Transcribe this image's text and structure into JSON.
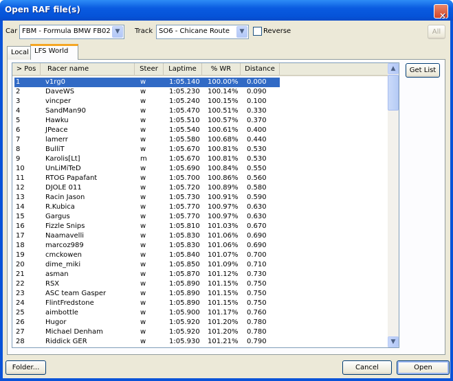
{
  "window": {
    "title": "Open RAF file(s)",
    "close_icon": "close-icon"
  },
  "toolbar": {
    "car_label": "Car",
    "car_value": "FBM - Formula BMW FB02",
    "track_label": "Track",
    "track_value": "SO6 - Chicane Route",
    "reverse_label": "Reverse",
    "reverse_checked": false,
    "all_label": "All"
  },
  "tabs": [
    {
      "label": "Local",
      "active": false
    },
    {
      "label": "LFS World",
      "active": true
    }
  ],
  "table": {
    "columns": [
      "> Pos",
      "Racer name",
      "Steer",
      "Laptime",
      "% WR",
      "Distance"
    ],
    "rows": [
      [
        "1",
        "v1rg0",
        "w",
        "1:05.140",
        "100.00%",
        "0.000"
      ],
      [
        "2",
        "DaveWS",
        "w",
        "1:05.230",
        "100.14%",
        "0.090"
      ],
      [
        "3",
        "vincper",
        "w",
        "1:05.240",
        "100.15%",
        "0.100"
      ],
      [
        "4",
        "SandMan90",
        "w",
        "1:05.470",
        "100.51%",
        "0.330"
      ],
      [
        "5",
        "Hawku",
        "w",
        "1:05.510",
        "100.57%",
        "0.370"
      ],
      [
        "6",
        "JPeace",
        "w",
        "1:05.540",
        "100.61%",
        "0.400"
      ],
      [
        "7",
        "lamerr",
        "w",
        "1:05.580",
        "100.68%",
        "0.440"
      ],
      [
        "8",
        "BulliT",
        "w",
        "1:05.670",
        "100.81%",
        "0.530"
      ],
      [
        "9",
        "Karolis[Lt]",
        "m",
        "1:05.670",
        "100.81%",
        "0.530"
      ],
      [
        "10",
        "UnLiMiTeD",
        "w",
        "1:05.690",
        "100.84%",
        "0.550"
      ],
      [
        "11",
        "RTOG Papafant",
        "w",
        "1:05.700",
        "100.86%",
        "0.560"
      ],
      [
        "12",
        "DJOLE 011",
        "w",
        "1:05.720",
        "100.89%",
        "0.580"
      ],
      [
        "13",
        "Racin Jason",
        "w",
        "1:05.730",
        "100.91%",
        "0.590"
      ],
      [
        "14",
        "R.Kubica",
        "w",
        "1:05.770",
        "100.97%",
        "0.630"
      ],
      [
        "15",
        "Gargus",
        "w",
        "1:05.770",
        "100.97%",
        "0.630"
      ],
      [
        "16",
        "Fizzle Snips",
        "w",
        "1:05.810",
        "101.03%",
        "0.670"
      ],
      [
        "17",
        "Naamavelli",
        "w",
        "1:05.830",
        "101.06%",
        "0.690"
      ],
      [
        "18",
        "marcoz989",
        "w",
        "1:05.830",
        "101.06%",
        "0.690"
      ],
      [
        "19",
        "cmckowen",
        "w",
        "1:05.840",
        "101.07%",
        "0.700"
      ],
      [
        "20",
        "dime_miki",
        "w",
        "1:05.850",
        "101.09%",
        "0.710"
      ],
      [
        "21",
        "asman",
        "w",
        "1:05.870",
        "101.12%",
        "0.730"
      ],
      [
        "22",
        "RSX",
        "w",
        "1:05.890",
        "101.15%",
        "0.750"
      ],
      [
        "23",
        "ASC team Gasper",
        "w",
        "1:05.890",
        "101.15%",
        "0.750"
      ],
      [
        "24",
        "FlintFredstone",
        "w",
        "1:05.890",
        "101.15%",
        "0.750"
      ],
      [
        "25",
        "aimbottle",
        "w",
        "1:05.900",
        "101.17%",
        "0.760"
      ],
      [
        "26",
        "Hugor",
        "w",
        "1:05.920",
        "101.20%",
        "0.780"
      ],
      [
        "27",
        "Michael Denham",
        "w",
        "1:05.920",
        "101.20%",
        "0.780"
      ],
      [
        "28",
        "Riddick GER",
        "w",
        "1:05.930",
        "101.21%",
        "0.790"
      ]
    ],
    "selected_index": 0
  },
  "buttons": {
    "get_list": "Get List",
    "folder": "Folder...",
    "cancel": "Cancel",
    "open": "Open"
  },
  "colors": {
    "selection": "#316ac5",
    "titlebar": "#0a5be0",
    "dialog_bg": "#ece9d8"
  }
}
